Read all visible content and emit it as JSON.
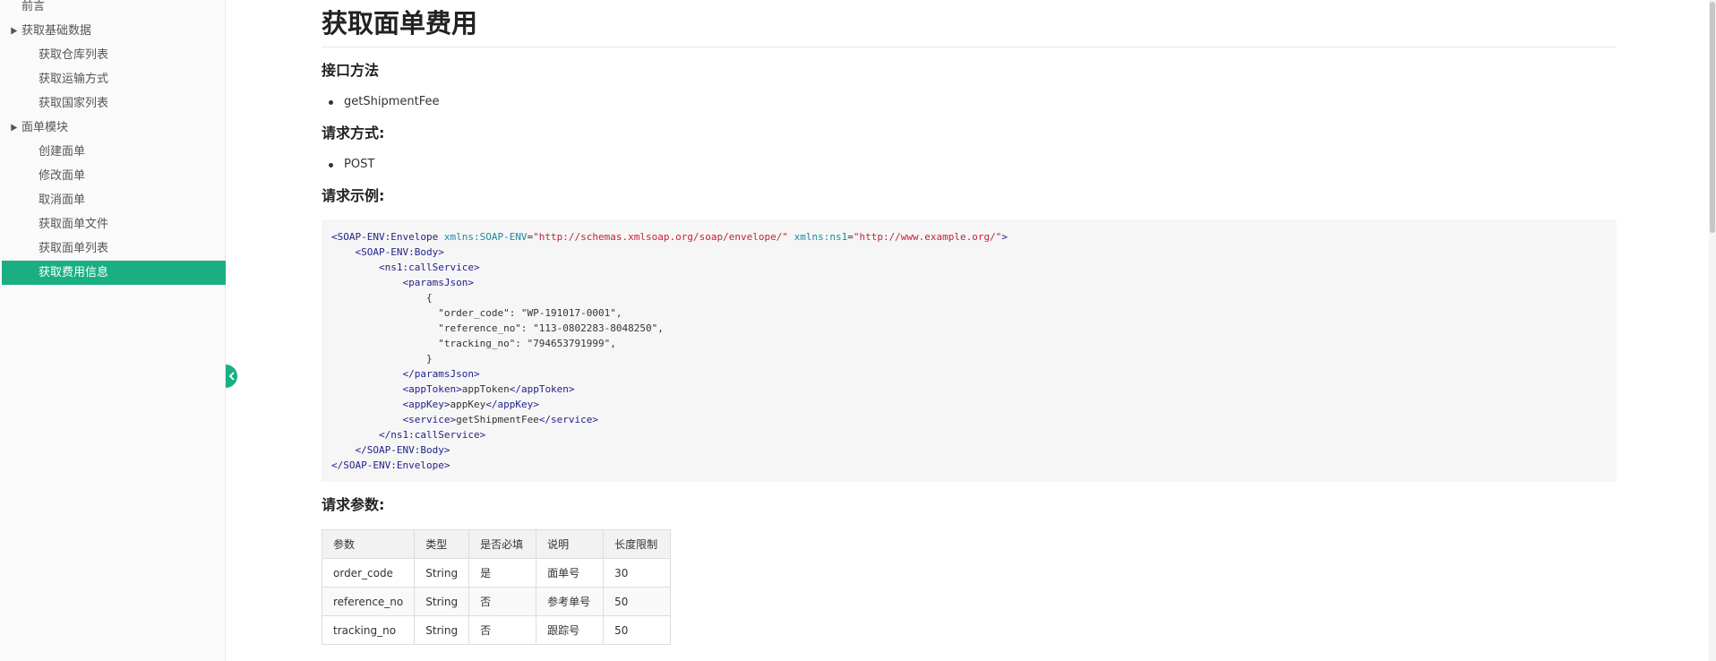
{
  "sidebar": {
    "items": [
      {
        "label": "前言"
      },
      {
        "label": "获取基础数据"
      },
      {
        "label": "获取仓库列表"
      },
      {
        "label": "获取运输方式"
      },
      {
        "label": "获取国家列表"
      },
      {
        "label": "面单模块"
      },
      {
        "label": "创建面单"
      },
      {
        "label": "修改面单"
      },
      {
        "label": "取消面单"
      },
      {
        "label": "获取面单文件"
      },
      {
        "label": "获取面单列表"
      },
      {
        "label": "获取费用信息"
      }
    ],
    "active_color": "#1aaf83"
  },
  "page": {
    "title": "获取面单费用",
    "interface_method_heading": "接口方法",
    "interface_method": "getShipmentFee",
    "request_method_heading": "请求方式:",
    "request_method": "POST",
    "request_example_heading": "请求示例:",
    "request_params_heading": "请求参数:"
  },
  "code": {
    "l1_open": "<SOAP-ENV:Envelope",
    "l1_attr1": "xmlns:SOAP-ENV",
    "l1_val1": "\"http://schemas.xmlsoap.org/soap/envelope/\"",
    "l1_attr2": "xmlns:ns1",
    "l1_val2": "\"http://www.example.org/\"",
    "l2": "<SOAP-ENV:Body>",
    "l3": "<ns1:callService>",
    "l4": "<paramsJson>",
    "l5": "{",
    "l6": "\"order_code\": \"WP-191017-0001\",",
    "l7": "\"reference_no\": \"113-0802283-8048250\",",
    "l8": "\"tracking_no\": \"794653791999\",",
    "l9": "}",
    "l10": "</paramsJson>",
    "l11_open": "<appToken>",
    "l11_text": "appToken",
    "l11_close": "</appToken>",
    "l12_open": "<appKey>",
    "l12_text": "appKey",
    "l12_close": "</appKey>",
    "l13_open": "<service>",
    "l13_text": "getShipmentFee",
    "l13_close": "</service>",
    "l14": "</ns1:callService>",
    "l15": "</SOAP-ENV:Body>",
    "l16": "</SOAP-ENV:Envelope>"
  },
  "table": {
    "headers": [
      "参数",
      "类型",
      "是否必填",
      "说明",
      "长度限制"
    ],
    "rows": [
      [
        "order_code",
        "String",
        "是",
        "面单号",
        "30"
      ],
      [
        "reference_no",
        "String",
        "否",
        "参考单号",
        "50"
      ],
      [
        "tracking_no",
        "String",
        "否",
        "跟踪号",
        "50"
      ]
    ]
  }
}
